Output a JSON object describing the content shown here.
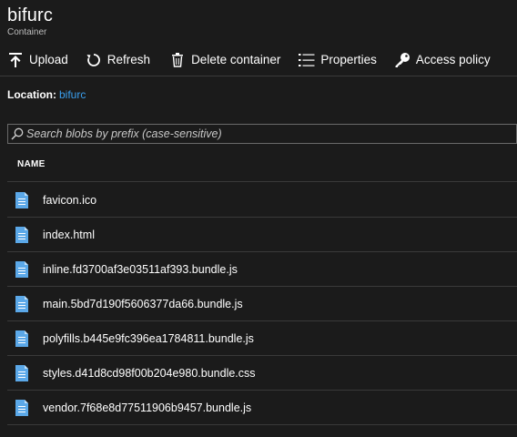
{
  "header": {
    "title": "bifurc",
    "subtitle": "Container"
  },
  "toolbar": {
    "upload": "Upload",
    "refresh": "Refresh",
    "delete_container": "Delete container",
    "properties": "Properties",
    "access_policy": "Access policy"
  },
  "location": {
    "label": "Location:",
    "value": "bifurc"
  },
  "search": {
    "placeholder": "Search blobs by prefix (case-sensitive)"
  },
  "table": {
    "column_name": "NAME",
    "rows": [
      {
        "name": "favicon.ico"
      },
      {
        "name": "index.html"
      },
      {
        "name": "inline.fd3700af3e03511af393.bundle.js"
      },
      {
        "name": "main.5bd7d190f5606377da66.bundle.js"
      },
      {
        "name": "polyfills.b445e9fc396ea1784811.bundle.js"
      },
      {
        "name": "styles.d41d8cd98f00b204e980.bundle.css"
      },
      {
        "name": "vendor.7f68e8d77511906b9457.bundle.js"
      }
    ]
  },
  "colors": {
    "background": "#1b1b1b",
    "link": "#3aa0f0",
    "file_icon": "#5ba8e8",
    "divider": "#3a3a3a"
  },
  "icons": {
    "upload": "upload-icon",
    "refresh": "refresh-icon",
    "delete": "trash-icon",
    "properties": "list-icon",
    "access_policy": "key-icon",
    "search": "search-icon",
    "file": "file-icon"
  }
}
